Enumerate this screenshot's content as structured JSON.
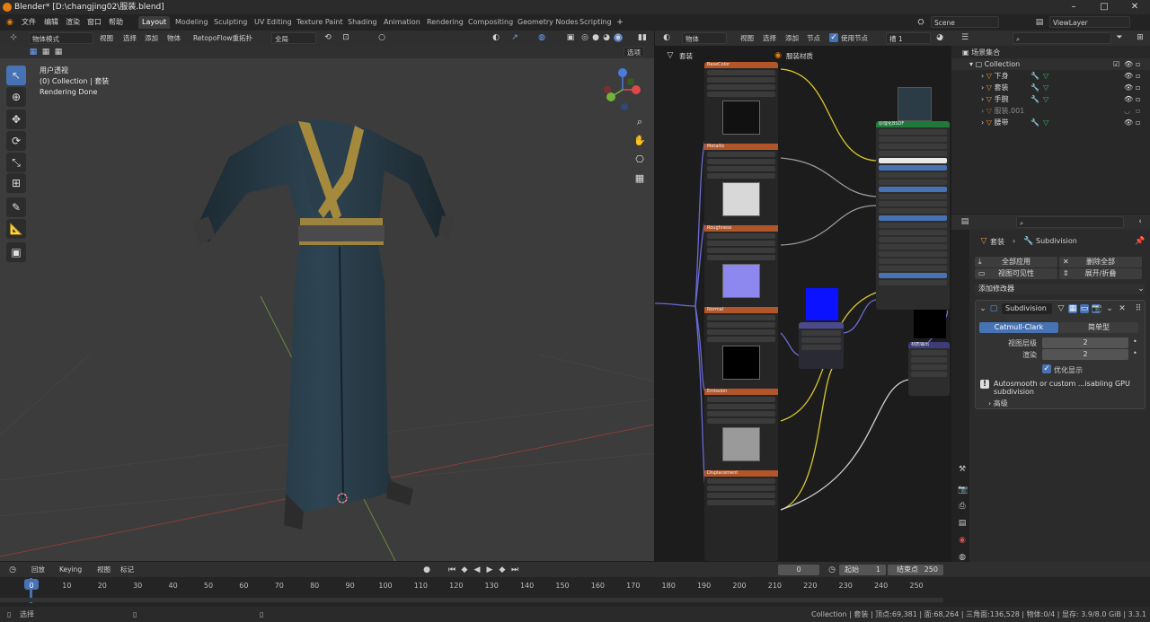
{
  "window": {
    "title": "Blender* [D:\\changjing02\\服装.blend]"
  },
  "menu": {
    "items": [
      "文件",
      "编辑",
      "渲染",
      "窗口",
      "帮助"
    ]
  },
  "workspaces": [
    "Layout",
    "Modeling",
    "Sculpting",
    "UV Editing",
    "Texture Paint",
    "Shading",
    "Animation",
    "Rendering",
    "Compositing",
    "Geometry Nodes",
    "Scripting"
  ],
  "scene": {
    "name": "Scene",
    "view_layer": "ViewLayer"
  },
  "viewport": {
    "mode": "物体模式",
    "menus": [
      "视图",
      "选择",
      "添加",
      "物体"
    ],
    "addon": "RetopoFlow重拓扑",
    "transform": "全局",
    "options": "选项",
    "overlay_lines": [
      "用户透视",
      "(0) Collection | 套装",
      "Rendering Done"
    ]
  },
  "node_editor": {
    "type": "物体",
    "menus": [
      "视图",
      "选择",
      "添加",
      "节点"
    ],
    "use_nodes": "使用节点",
    "slot": "槽 1",
    "breadcrumb_obj": "套装",
    "breadcrumb_mat": "服装材质",
    "texture_nodes": [
      "BaseColor",
      "Metallic",
      "Roughness",
      "Normal",
      "Emission",
      "Displacement"
    ],
    "bsdf_title": "原理化BSDF",
    "output_title": "材质输出"
  },
  "outliner": {
    "root": "场景集合",
    "collection": "Collection",
    "objects": [
      "下身",
      "套装",
      "手腕",
      "服装.001",
      "腰带"
    ]
  },
  "properties": {
    "search_placeholder": "",
    "breadcrumb_obj": "套装",
    "breadcrumb_mod": "Subdivision",
    "apply_all": "全部应用",
    "delete_all": "删除全部",
    "viewport_vis": "视图可见性",
    "expand_collapse": "展开/折叠",
    "add_modifier": "添加修改器",
    "modifier_name": "Subdivision",
    "mode_catmull": "Catmull-Clark",
    "mode_simple": "简单型",
    "levels_viewport_label": "视图层级",
    "levels_viewport": "2",
    "levels_render_label": "渲染",
    "levels_render": "2",
    "optimal_display": "优化显示",
    "warning": "Autosmooth or custom ...isabling GPU subdivision",
    "advanced": "高级"
  },
  "timeline": {
    "menus": [
      "回放",
      "Keying",
      "视图",
      "标记"
    ],
    "current_frame": "0",
    "start_label": "起始",
    "start": "1",
    "end_label": "结束点",
    "end": "250",
    "ticks": [
      "0",
      "10",
      "20",
      "30",
      "40",
      "50",
      "60",
      "70",
      "80",
      "90",
      "100",
      "110",
      "120",
      "130",
      "140",
      "150",
      "160",
      "170",
      "180",
      "190",
      "200",
      "210",
      "220",
      "230",
      "240",
      "250"
    ]
  },
  "status": {
    "left": "选择",
    "right": "Collection | 套装 | 顶点:69,381 | 面:68,264 | 三角面:136,528 | 物体:0/4 | 显存: 3.9/8.0 GiB | 3.3.1"
  }
}
